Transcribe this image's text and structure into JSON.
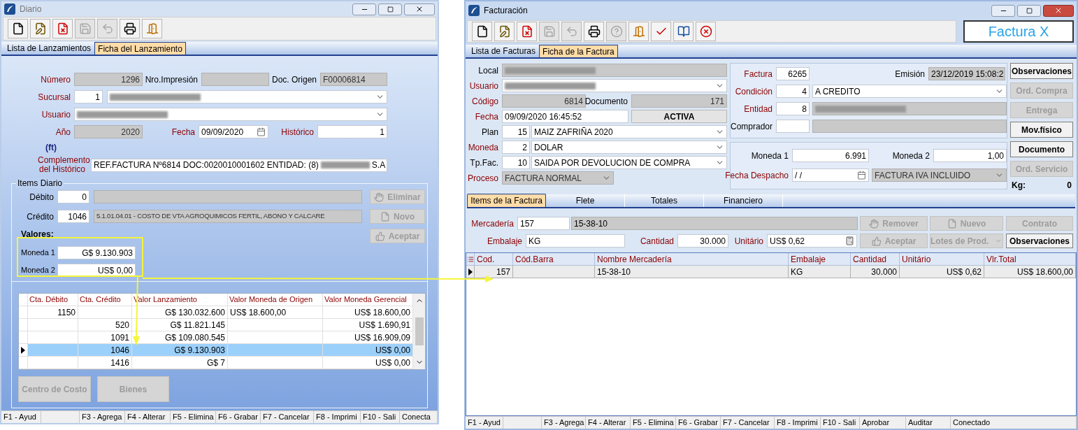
{
  "diario": {
    "title": "Diario",
    "active": false,
    "toolbar": [
      {
        "kind": "new",
        "disabled": false
      },
      {
        "kind": "edit",
        "disabled": false
      },
      {
        "kind": "delete",
        "disabled": false
      },
      {
        "kind": "save",
        "disabled": true
      },
      {
        "kind": "undo",
        "disabled": true
      },
      {
        "kind": "print",
        "disabled": false
      },
      {
        "kind": "exit",
        "disabled": false
      }
    ],
    "tabs": [
      {
        "label": "Lista de Lanzamientos",
        "selected": false
      },
      {
        "label": "Ficha del Lanzamiento",
        "selected": true
      }
    ],
    "numero": {
      "label": "Número",
      "required": true,
      "box": {
        "value": "1296",
        "disabled": true
      }
    },
    "nro_impresion": {
      "label": "Nro.Impresión",
      "required": false,
      "box": {
        "disabled": true
      }
    },
    "doc_origen": {
      "label": "Doc. Origen",
      "required": false,
      "box": {
        "value": "F00006814",
        "disabled": true
      }
    },
    "sucursal": {
      "label": "Sucursal",
      "required": true,
      "code": {
        "value": "1",
        "disabled": false
      },
      "box": {
        "redacted": true,
        "disabled": false
      }
    },
    "usuario": {
      "label": "Usuario",
      "required": true,
      "box": {
        "redacted": true,
        "disabled": false
      }
    },
    "ano": {
      "label": "Año",
      "required": true,
      "box": {
        "value": "2020",
        "disabled": true
      }
    },
    "fecha": {
      "label": "Fecha",
      "required": true,
      "box": {
        "value": "09/09/2020",
        "disabled": false
      }
    },
    "historico": {
      "label": "Histórico",
      "required": true,
      "box": {
        "value": "1",
        "disabled": false
      }
    },
    "ft": "(ft)",
    "complemento": {
      "label": "Complemento del Histórico",
      "required": true,
      "box": {
        "value": "REF.FACTURA Nº6814 DOC:0020010001602 ENTIDAD: (8)",
        "redacted": true,
        "suffix": "S.A",
        "disabled": false
      }
    },
    "items": {
      "legend": "Items Diario",
      "debito": {
        "label": "Débito",
        "required": false,
        "code": {
          "value": "0",
          "disabled": false
        },
        "box": {
          "disabled": true
        }
      },
      "credito": {
        "label": "Crédito",
        "required": false,
        "code": {
          "value": "1046",
          "disabled": false
        },
        "box": {
          "value": "5.1.01.04.01 - COSTO DE VTA AGROQUIMICOS FERTIL, ABONO Y CALCARE",
          "disabled": true
        }
      },
      "valores": "Valores:",
      "moneda1": {
        "label": "Moneda 1",
        "required": false,
        "box": {
          "value": "G$ 9.130.903",
          "disabled": false
        }
      },
      "moneda2": {
        "label": "Moneda 2",
        "required": false,
        "box": {
          "value": "US$ 0,00",
          "disabled": false
        }
      },
      "buttons": [
        {
          "label": "Eliminar",
          "kind": "hand",
          "disabled": true
        },
        {
          "label": "Novo",
          "kind": "file",
          "disabled": true
        },
        {
          "label": "Aceptar",
          "kind": "thumb",
          "disabled": true
        }
      ],
      "columns": [
        "Cta. Débito",
        "Cta. Crédito",
        "Valor Lanzamiento",
        "Valor Moneda de Origen",
        "Valor Moneda Gerencial"
      ],
      "rows": [
        {
          "cta_debito": "1150",
          "valor_lanzamiento": "G$ 130.032.600",
          "valor_origen": "US$ 18.600,00",
          "valor_gerencial": "US$ 18.600,00",
          "selected": false
        },
        {
          "cta_credito": "520",
          "valor_lanzamiento": "G$ 11.821.145",
          "valor_gerencial": "US$ 1.690,91",
          "selected": false
        },
        {
          "cta_credito": "1091",
          "valor_lanzamiento": "G$ 109.080.545",
          "valor_gerencial": "US$ 16.909,09",
          "selected": false
        },
        {
          "cta_credito": "1046",
          "valor_lanzamiento": "G$ 9.130.903",
          "valor_gerencial": "US$ 0,00",
          "selected": true
        },
        {
          "cta_credito": "1416",
          "valor_lanzamiento": "G$ 7",
          "valor_gerencial": "US$ 0,00",
          "selected": false
        }
      ],
      "bottom_buttons": [
        {
          "label": "Centro de Costo",
          "disabled": true
        },
        {
          "label": "Bienes",
          "disabled": true
        }
      ]
    },
    "status_bar": [
      "F1 - Ayud",
      "F3 - Agrega",
      "F4 - Alterar",
      "F5 - Elimina",
      "F6 - Grabar",
      "F7 - Cancelar",
      "F8 - Imprimi",
      "F10 - Sali",
      "Conecta"
    ]
  },
  "facturacion": {
    "title": "Facturación",
    "active": true,
    "toolbar": [
      {
        "kind": "new",
        "disabled": false
      },
      {
        "kind": "edit",
        "disabled": false
      },
      {
        "kind": "delete",
        "disabled": false
      },
      {
        "kind": "save",
        "disabled": true
      },
      {
        "kind": "undo",
        "disabled": true
      },
      {
        "kind": "print",
        "disabled": false
      },
      {
        "kind": "help",
        "disabled": true
      },
      {
        "kind": "exit",
        "disabled": false
      },
      {
        "kind": "confirm",
        "disabled": false
      },
      {
        "kind": "book",
        "disabled": false
      },
      {
        "kind": "cancel",
        "disabled": false
      }
    ],
    "brand": "Factura X",
    "tabs": [
      {
        "label": "Lista de Facturas",
        "selected": false
      },
      {
        "label": "Ficha de la Factura",
        "selected": true
      }
    ],
    "local": {
      "label": "Local",
      "required": false,
      "box": {
        "redacted": true,
        "disabled": true
      }
    },
    "usuario": {
      "label": "Usuario",
      "required": true,
      "box": {
        "redacted": true,
        "disabled": false
      }
    },
    "codigo": {
      "label": "Código",
      "required": true,
      "box": {
        "value": "6814",
        "disabled": true
      }
    },
    "documento": {
      "label": "Documento",
      "required": false,
      "box": {
        "value": "171",
        "disabled": true
      }
    },
    "fecha": {
      "label": "Fecha",
      "required": true,
      "box": {
        "value": "09/09/2020 16:45:52",
        "disabled": false
      }
    },
    "estado": "ACTIVA",
    "plan": {
      "label": "Plan",
      "required": false,
      "code": {
        "value": "15",
        "disabled": false
      },
      "box": {
        "value": "MAIZ ZAFRIÑA 2020",
        "disabled": false
      }
    },
    "moneda": {
      "label": "Moneda",
      "required": true,
      "code": {
        "value": "2",
        "disabled": false
      },
      "box": {
        "value": "DOLAR",
        "disabled": false
      }
    },
    "tp_fac": {
      "label": "Tp.Fac.",
      "required": false,
      "code": {
        "value": "10",
        "disabled": false
      },
      "box": {
        "value": "SAIDA POR DEVOLUCION DE COMPRA",
        "disabled": false
      }
    },
    "proceso": {
      "label": "Proceso",
      "required": true,
      "box": {
        "value": "FACTURA NORMAL",
        "disabled": true
      }
    },
    "factura": {
      "label": "Factura",
      "required": true,
      "code": {
        "value": "6265",
        "disabled": false
      }
    },
    "emision": {
      "label": "Emisión",
      "required": false,
      "box": {
        "value": "23/12/2019 15:08:2",
        "disabled": true
      }
    },
    "condicion": {
      "label": "Condición",
      "required": true,
      "code": {
        "value": "4",
        "disabled": false
      },
      "box": {
        "value": "A CREDITO",
        "disabled": false
      }
    },
    "entidad": {
      "label": "Entidad",
      "required": true,
      "code": {
        "value": "8",
        "disabled": false
      },
      "box": {
        "redacted": true,
        "disabled": true
      }
    },
    "comprador": {
      "label": "Comprador",
      "required": false,
      "code": {
        "disabled": false
      },
      "box": {
        "disabled": true
      }
    },
    "moneda1": {
      "label": "Moneda 1",
      "required": false,
      "box": {
        "value": "6.991",
        "disabled": false
      }
    },
    "moneda2": {
      "label": "Moneda 2",
      "required": false,
      "box": {
        "value": "1,00",
        "disabled": false
      }
    },
    "fecha_despacho": {
      "label": "Fecha Despacho",
      "required": true,
      "box": {
        "value": "/ /",
        "disabled": false
      }
    },
    "tipo_iva": {
      "box": {
        "value": "FACTURA IVA INCLUIDO",
        "disabled": true
      }
    },
    "side_buttons": [
      {
        "label": "Observaciones",
        "disabled": false
      },
      {
        "label": "Ord. Compra",
        "disabled": true
      },
      {
        "label": "Entrega",
        "disabled": true
      },
      {
        "label": "Mov.físico",
        "disabled": false
      },
      {
        "label": "Documento",
        "disabled": false
      },
      {
        "label": "Ord. Servicio",
        "disabled": true
      }
    ],
    "kg": {
      "label": "Kg:",
      "value": "0"
    },
    "item_tabs": [
      {
        "label": "Items de la Factura",
        "selected": true
      },
      {
        "label": "Flete",
        "selected": false
      },
      {
        "label": "Totales",
        "selected": false
      },
      {
        "label": "Financiero",
        "selected": false
      }
    ],
    "mercaderia": {
      "label": "Mercadería",
      "required": true,
      "code": {
        "value": "157",
        "disabled": false
      },
      "box": {
        "value": "15-38-10",
        "disabled": true
      }
    },
    "embalaje": {
      "label": "Embalaje",
      "required": true,
      "box": {
        "value": "KG",
        "disabled": false
      }
    },
    "cantidad": {
      "label": "Cantidad",
      "required": true,
      "box": {
        "value": "30.000",
        "disabled": false
      }
    },
    "unitario": {
      "label": "Unitário",
      "required": true,
      "box": {
        "value": "US$ 0,62",
        "disabled": false
      }
    },
    "item_buttons": [
      {
        "label": "Remover",
        "kind": "hand",
        "disabled": true
      },
      {
        "label": "Nuevo",
        "kind": "file",
        "disabled": true
      },
      {
        "label": "Contrato",
        "kind": "plain",
        "disabled": true
      },
      {
        "label": "Aceptar",
        "kind": "thumb",
        "disabled": true
      },
      {
        "label": "Lotes de Prod.",
        "kind": "dropdown",
        "disabled": true
      },
      {
        "label": "Observaciones",
        "kind": "plain",
        "disabled": false
      }
    ],
    "columns": [
      "Cod.",
      "Cód.Barra",
      "Nombre Mercadería",
      "Embalaje",
      "Cantidad",
      "Unitário",
      "Vlr.Total"
    ],
    "rows": [
      {
        "cod": "157",
        "nombre": "15-38-10",
        "embalaje": "KG",
        "cantidad": "30.000",
        "unitario": "US$ 0,62",
        "vlr_total": "US$ 18.600,00",
        "selected": true
      }
    ],
    "status_bar": [
      "F1 - Ayud",
      "F3 - Agrega",
      "F4 - Alterar",
      "F5 - Elimina",
      "F6 - Grabar",
      "F7 - Cancelar",
      "F8 - Imprimi",
      "F10 - Sali",
      "Aprobar",
      "Auditar",
      "Conectado"
    ]
  }
}
